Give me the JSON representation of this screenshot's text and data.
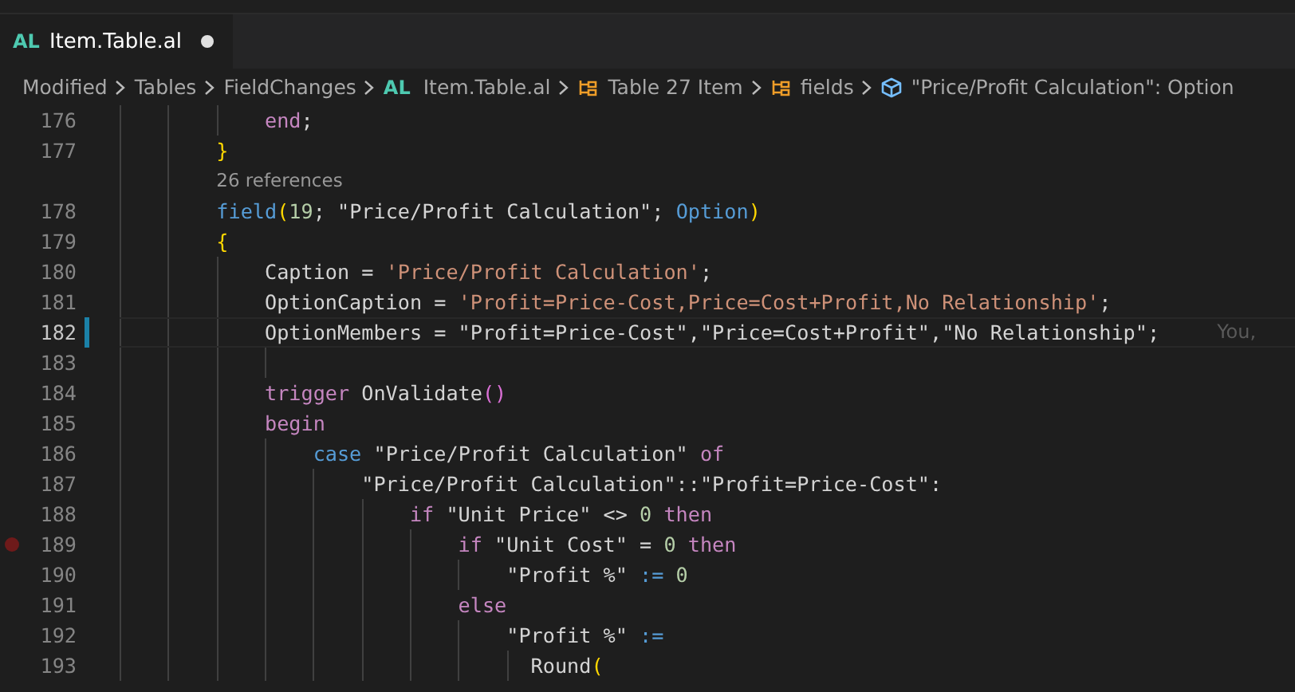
{
  "tabs": [
    {
      "badge": "AL",
      "label": "Item.Table.al",
      "modified": true,
      "selected": true
    }
  ],
  "breadcrumbs": [
    {
      "kind": "folder",
      "label": "Modified"
    },
    {
      "kind": "folder",
      "label": "Tables"
    },
    {
      "kind": "folder",
      "label": "FieldChanges"
    },
    {
      "kind": "file",
      "badge": "AL",
      "label": "Item.Table.al"
    },
    {
      "kind": "namespace",
      "label": "Table 27 Item"
    },
    {
      "kind": "namespace",
      "label": "fields"
    },
    {
      "kind": "field",
      "label": "\"Price/Profit Calculation\": Option"
    }
  ],
  "lines": [
    {
      "kind": "code",
      "number": "176",
      "tokens": [
        {
          "t": "            end",
          "kind": "ctl"
        },
        {
          "t": ";",
          "kind": "plain"
        }
      ]
    },
    {
      "kind": "code",
      "number": "177",
      "tokens": [
        {
          "t": "        }",
          "kind": "br1"
        }
      ]
    },
    {
      "kind": "codelens",
      "text": "26 references"
    },
    {
      "kind": "code",
      "number": "178",
      "tokens": [
        {
          "t": "        field",
          "kind": "kw"
        },
        {
          "t": "(",
          "kind": "br1"
        },
        {
          "t": "19",
          "kind": "num"
        },
        {
          "t": "; \"Price/Profit Calculation\"; ",
          "kind": "plain"
        },
        {
          "t": "Option",
          "kind": "kw"
        },
        {
          "t": ")",
          "kind": "br1"
        }
      ]
    },
    {
      "kind": "code",
      "number": "179",
      "tokens": [
        {
          "t": "        {",
          "kind": "br1"
        }
      ]
    },
    {
      "kind": "code",
      "number": "180",
      "tokens": [
        {
          "t": "            Caption = ",
          "kind": "plain"
        },
        {
          "t": "'Price/Profit Calculation'",
          "kind": "str"
        },
        {
          "t": ";",
          "kind": "plain"
        }
      ]
    },
    {
      "kind": "code",
      "number": "181",
      "tokens": [
        {
          "t": "            OptionCaption = ",
          "kind": "plain"
        },
        {
          "t": "'Profit=Price-Cost,Price=Cost+Profit,No Relationship'",
          "kind": "str"
        },
        {
          "t": ";",
          "kind": "plain"
        }
      ]
    },
    {
      "kind": "code",
      "number": "182",
      "current": true,
      "modified": true,
      "blame": "You,",
      "tokens": [
        {
          "t": "            OptionMembers = \"Profit=Price-Cost\",\"Price=Cost+Profit\",\"No Relationship\";",
          "kind": "plain"
        }
      ]
    },
    {
      "kind": "code",
      "number": "183"
    },
    {
      "kind": "code",
      "number": "184",
      "tokens": [
        {
          "t": "            trigger",
          "kind": "ctl"
        },
        {
          "t": " OnValidate",
          "kind": "plain"
        },
        {
          "t": "()",
          "kind": "br2"
        }
      ]
    },
    {
      "kind": "code",
      "number": "185",
      "tokens": [
        {
          "t": "            begin",
          "kind": "ctl"
        }
      ]
    },
    {
      "kind": "code",
      "number": "186",
      "tokens": [
        {
          "t": "                case",
          "kind": "kw"
        },
        {
          "t": " \"Price/Profit Calculation\" ",
          "kind": "plain"
        },
        {
          "t": "of",
          "kind": "ctl"
        }
      ]
    },
    {
      "kind": "code",
      "number": "187",
      "tokens": [
        {
          "t": "                    \"Price/Profit Calculation\"::\"Profit=Price-Cost\":",
          "kind": "plain"
        }
      ]
    },
    {
      "kind": "code",
      "number": "188",
      "tokens": [
        {
          "t": "                        if",
          "kind": "ctl"
        },
        {
          "t": " \"Unit Price\" <> ",
          "kind": "plain"
        },
        {
          "t": "0",
          "kind": "num"
        },
        {
          "t": " then",
          "kind": "ctl"
        }
      ]
    },
    {
      "kind": "code",
      "number": "189",
      "breakpoint": true,
      "tokens": [
        {
          "t": "                            if",
          "kind": "ctl"
        },
        {
          "t": " \"Unit Cost\" = ",
          "kind": "plain"
        },
        {
          "t": "0",
          "kind": "num"
        },
        {
          "t": " then",
          "kind": "ctl"
        }
      ]
    },
    {
      "kind": "code",
      "number": "190",
      "tokens": [
        {
          "t": "                                \"Profit %\" ",
          "kind": "plain"
        },
        {
          "t": ":=",
          "kind": "kw"
        },
        {
          "t": " 0",
          "kind": "num"
        }
      ]
    },
    {
      "kind": "code",
      "number": "191",
      "tokens": [
        {
          "t": "                            else",
          "kind": "ctl"
        }
      ]
    },
    {
      "kind": "code",
      "number": "192",
      "tokens": [
        {
          "t": "                                \"Profit %\" ",
          "kind": "plain"
        },
        {
          "t": ":=",
          "kind": "kw"
        }
      ]
    },
    {
      "kind": "code",
      "number": "193",
      "tokens": [
        {
          "t": "                                  Round",
          "kind": "plain"
        },
        {
          "t": "(",
          "kind": "br1"
        }
      ]
    }
  ]
}
